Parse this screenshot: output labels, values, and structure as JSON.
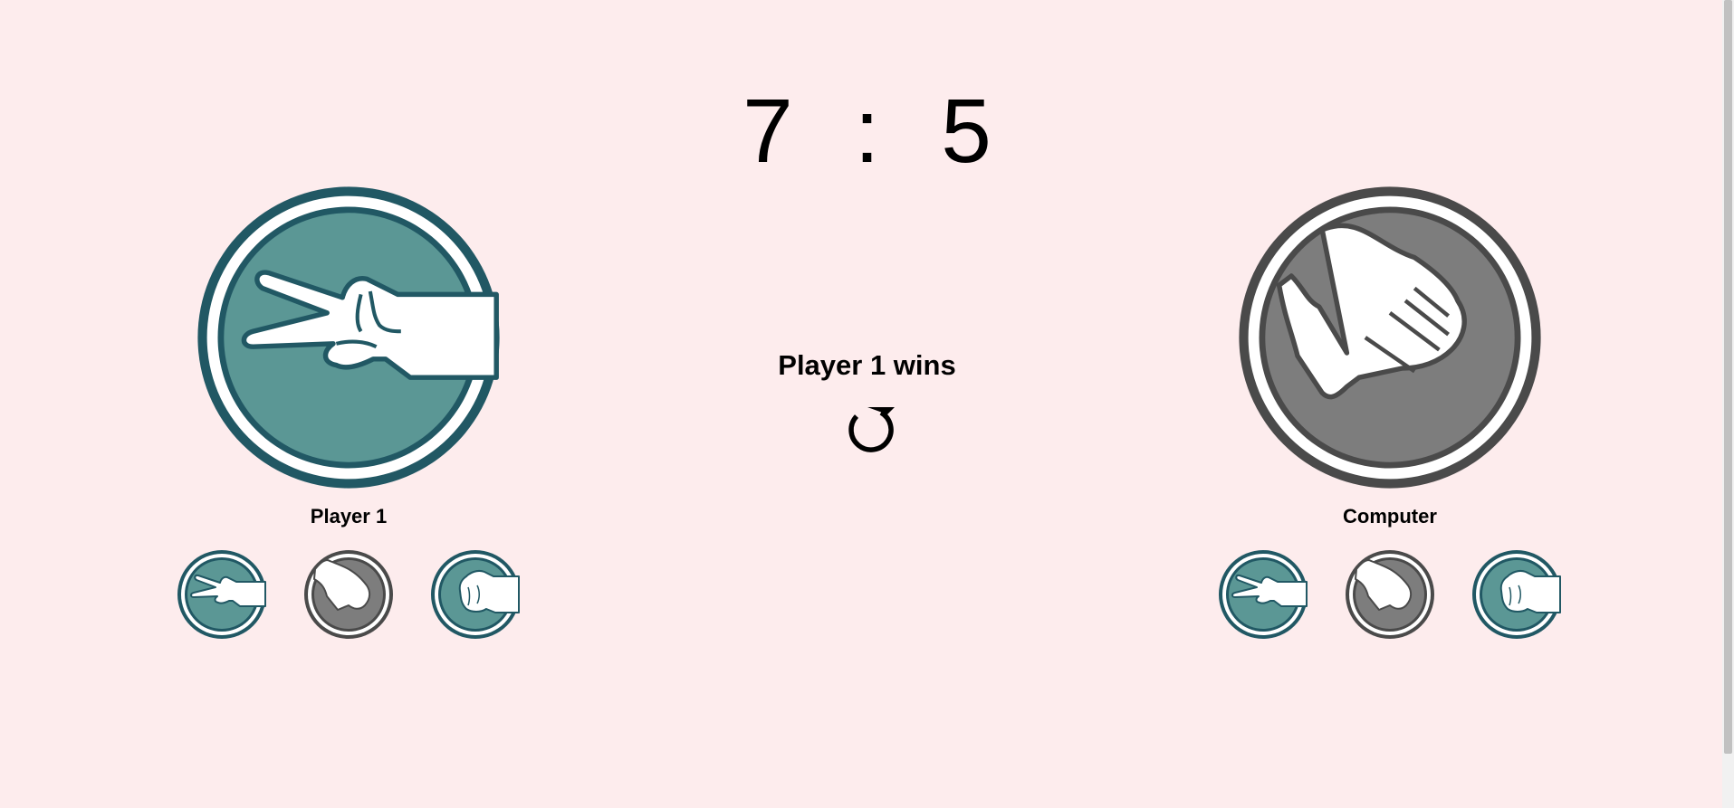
{
  "score": {
    "player1": "7",
    "separator": ":",
    "computer": "5"
  },
  "result": {
    "message": "Player 1 wins"
  },
  "players": {
    "left": {
      "name": "Player 1",
      "selected": "scissors-icon"
    },
    "right": {
      "name": "Computer",
      "selected": "paper-icon"
    }
  },
  "choices": [
    "scissors-icon",
    "paper-icon",
    "rock-icon"
  ],
  "colors": {
    "background": "#fdeced",
    "teal": "#5b9795",
    "teal_dark": "#215864",
    "gray": "#7d7d7d",
    "gray_dark": "#4a4a4a"
  },
  "icons": {
    "restart": "restart-icon"
  }
}
